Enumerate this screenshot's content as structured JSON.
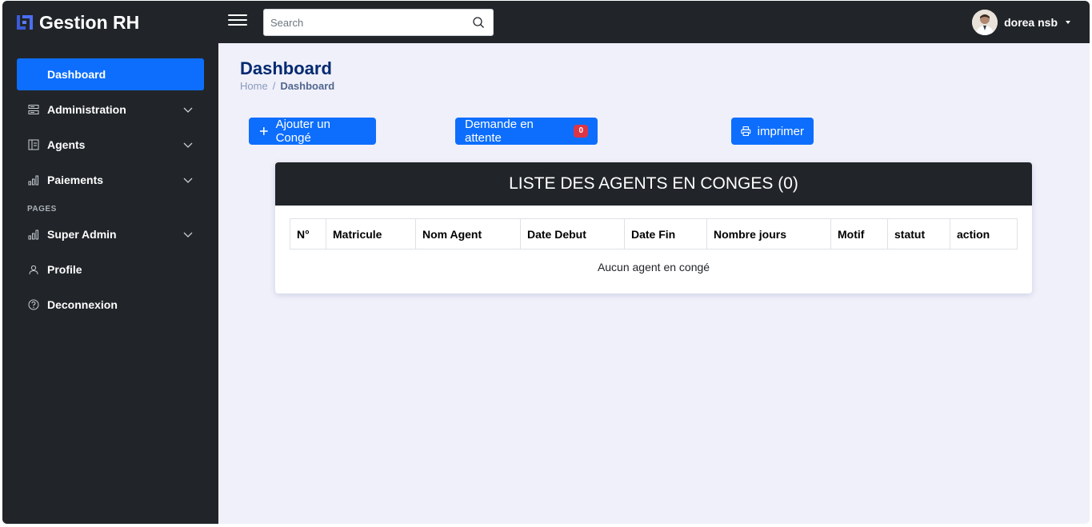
{
  "app": {
    "title": "Gestion RH"
  },
  "search": {
    "placeholder": "Search"
  },
  "user": {
    "name": "dorea nsb"
  },
  "sidebar": {
    "items": [
      {
        "label": "Dashboard",
        "icon": "grid-icon",
        "active": true
      },
      {
        "label": "Administration",
        "icon": "server-icon"
      },
      {
        "label": "Agents",
        "icon": "layout-text-icon"
      },
      {
        "label": "Paiements",
        "icon": "bar-chart-icon"
      },
      {
        "label": "Super Admin",
        "icon": "bar-chart-icon"
      },
      {
        "label": "Profile",
        "icon": "person-icon"
      },
      {
        "label": "Deconnexion",
        "icon": "question-circle-icon"
      }
    ],
    "section_heading": "PAGES"
  },
  "page": {
    "title": "Dashboard",
    "breadcrumb": {
      "home": "Home",
      "separator": "/",
      "current": "Dashboard"
    }
  },
  "actions": {
    "add_leave": "Ajouter un Congé",
    "pending_requests": "Demande en attente",
    "pending_count": "0",
    "print": "imprimer"
  },
  "table": {
    "title": "LISTE DES AGENTS EN CONGES (0)",
    "columns": [
      "N°",
      "Matricule",
      "Nom Agent",
      "Date Debut",
      "Date Fin",
      "Nombre jours",
      "Motif",
      "statut",
      "action"
    ],
    "empty_message": "Aucun agent en congé"
  },
  "colors": {
    "primary": "#0d6efd",
    "dark": "#212529",
    "danger": "#dc3545",
    "title": "#012970"
  }
}
